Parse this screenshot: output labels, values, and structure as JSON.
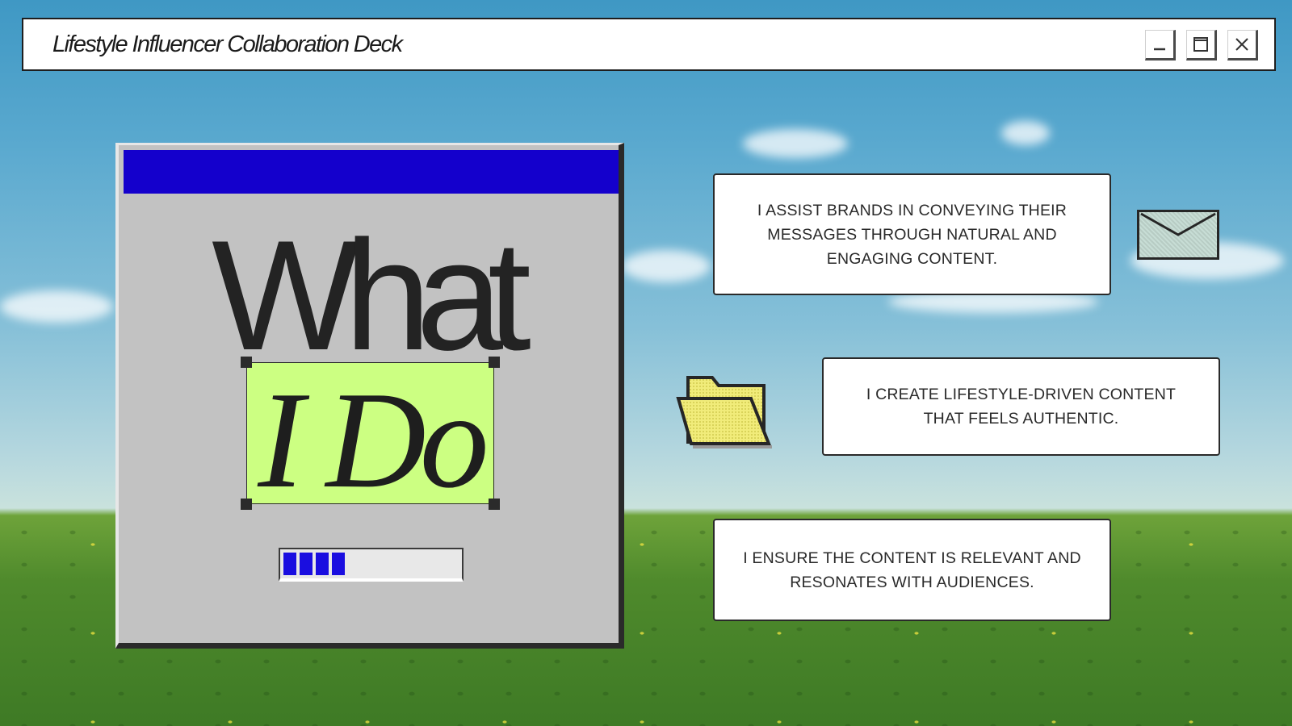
{
  "window": {
    "title": "Lifestyle Influencer Collaboration Deck",
    "controls": [
      "minimize",
      "maximize",
      "close"
    ]
  },
  "dialog": {
    "heading_line1": "What",
    "heading_line2": "I Do",
    "progress_percent": 40,
    "progress_segments_filled": 4
  },
  "cards": [
    {
      "text": "I ASSIST BRANDS IN CONVEYING THEIR MESSAGES THROUGH NATURAL AND ENGAGING CONTENT."
    },
    {
      "text": "I CREATE LIFESTYLE-DRIVEN CONTENT THAT FEELS AUTHENTIC."
    },
    {
      "text": "I ENSURE THE CONTENT IS RELEVANT AND RESONATES WITH AUDIENCES."
    }
  ],
  "icons": [
    "minimize-icon",
    "maximize-icon",
    "close-icon",
    "envelope-icon",
    "folder-icon"
  ],
  "colors": {
    "dialog_titlebar": "#1400cc",
    "highlight": "#ccff82",
    "progress": "#1a0ee0",
    "dialog_body": "#c2c2c2",
    "folder": "#f1ec7a"
  }
}
